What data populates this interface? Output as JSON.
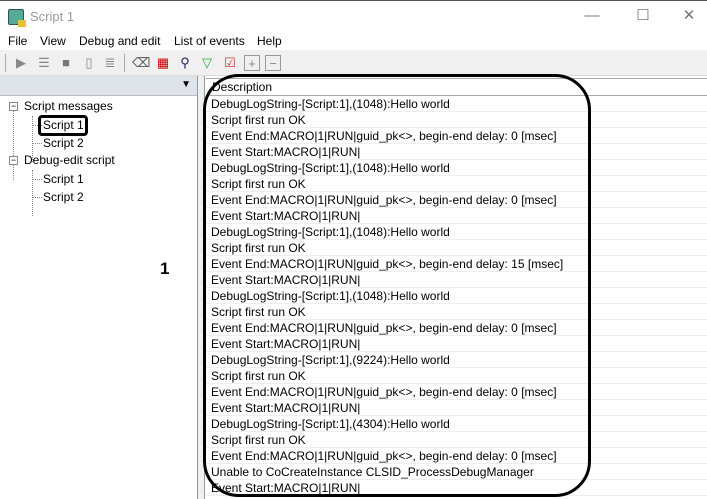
{
  "window": {
    "title": "Script 1",
    "minimize": "—",
    "maximize": "☐",
    "close": "✕"
  },
  "menu": [
    "File",
    "View",
    "Debug and edit",
    "List of events",
    "Help"
  ],
  "toolbar": [
    "run-icon",
    "step-icon",
    "save-icon",
    "edit-icon",
    "list-icon",
    "eraser-icon",
    "colors-icon",
    "find-icon",
    "filter-icon",
    "filter-check-icon",
    "plus-icon",
    "minus-icon"
  ],
  "left_panel": {
    "pin": "📌",
    "tree": [
      {
        "label": "Script messages",
        "expander": "−",
        "children": [
          "Script 1",
          "Script 2"
        ]
      },
      {
        "label": "Debug-edit script",
        "expander": "−",
        "children": [
          "Script 1",
          "Script 2"
        ]
      }
    ],
    "selected": "Script 1"
  },
  "list": {
    "header": "Description",
    "rows": [
      "DebugLogString-[Script:1],(1048):Hello world",
      "Script first run OK",
      "Event End:MACRO|1|RUN|guid_pk<>, begin-end delay: 0 [msec]",
      "Event Start:MACRO|1|RUN|",
      "DebugLogString-[Script:1],(1048):Hello world",
      "Script first run OK",
      "Event End:MACRO|1|RUN|guid_pk<>, begin-end delay: 0 [msec]",
      "Event Start:MACRO|1|RUN|",
      "DebugLogString-[Script:1],(1048):Hello world",
      "Script first run OK",
      "Event End:MACRO|1|RUN|guid_pk<>, begin-end delay: 15 [msec]",
      "Event Start:MACRO|1|RUN|",
      "DebugLogString-[Script:1],(1048):Hello world",
      "Script first run OK",
      "Event End:MACRO|1|RUN|guid_pk<>, begin-end delay: 0 [msec]",
      "Event Start:MACRO|1|RUN|",
      "DebugLogString-[Script:1],(9224):Hello world",
      "Script first run OK",
      "Event End:MACRO|1|RUN|guid_pk<>, begin-end delay: 0 [msec]",
      "Event Start:MACRO|1|RUN|",
      "DebugLogString-[Script:1],(4304):Hello world",
      "Script first run OK",
      "Event End:MACRO|1|RUN|guid_pk<>, begin-end delay: 0 [msec]",
      "Unable to CoCreateInstance CLSID_ProcessDebugManager",
      "Event Start:MACRO|1|RUN|"
    ]
  },
  "callout": {
    "number": "1"
  }
}
